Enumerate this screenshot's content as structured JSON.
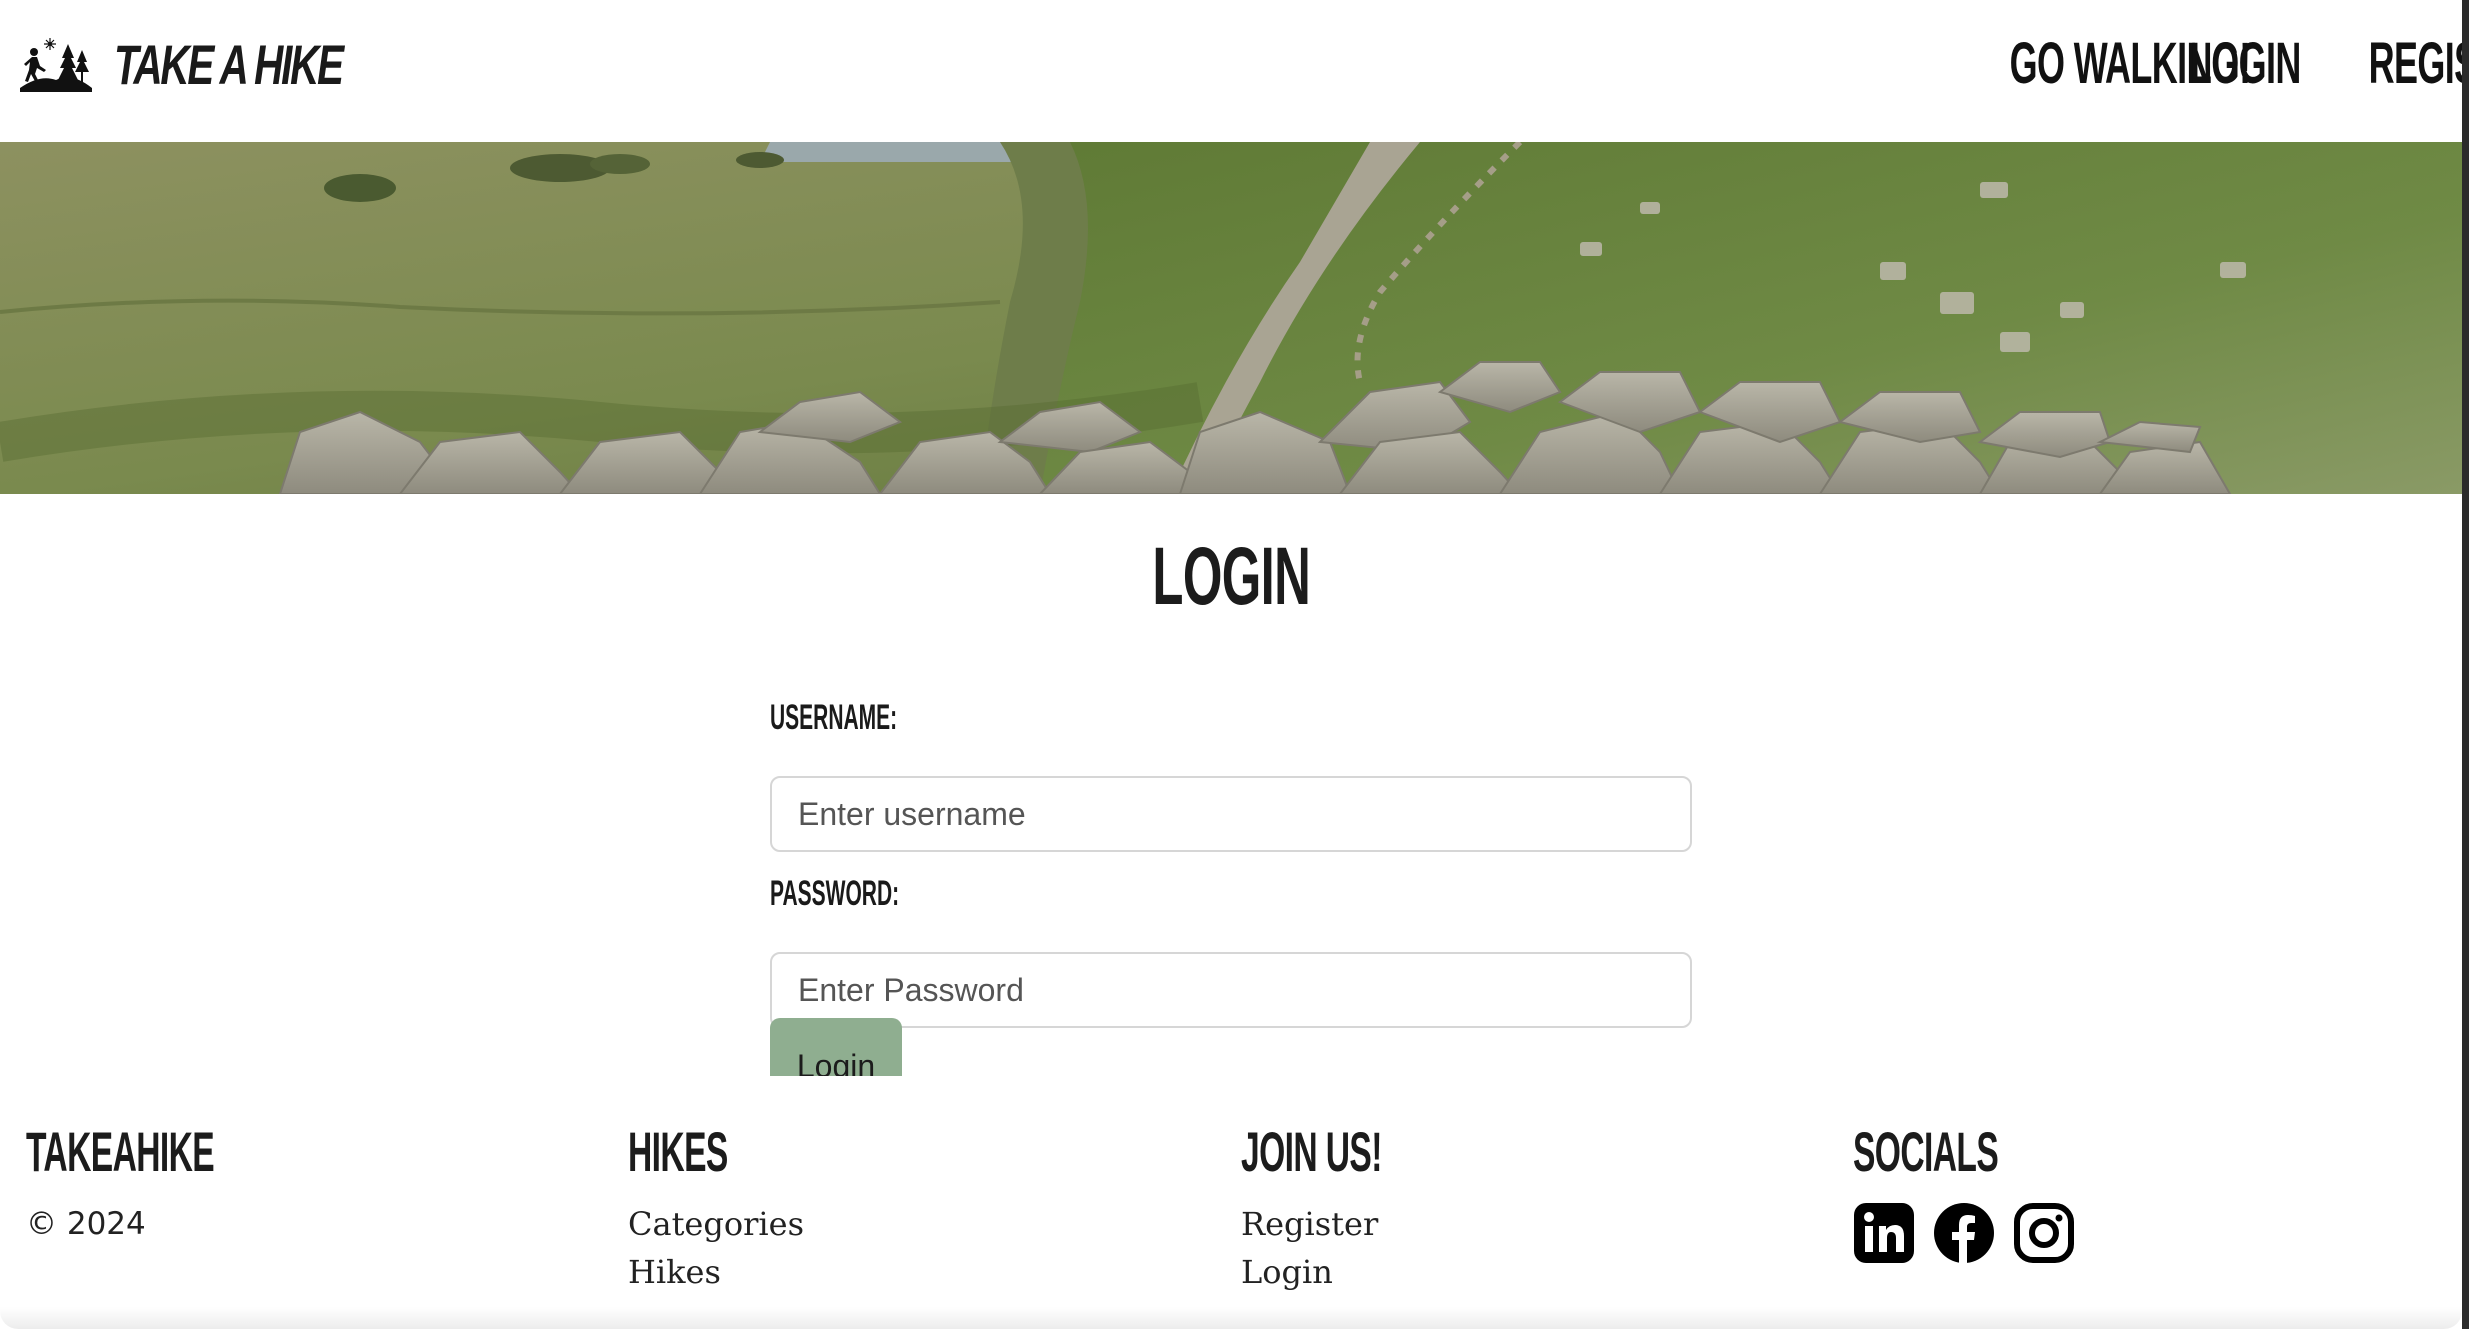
{
  "navbar": {
    "brand": "TAKE A HIKE",
    "brand_icon": "hiker-trees-icon",
    "links": [
      "GO WALKING!",
      "LOGIN",
      "REGISTER"
    ]
  },
  "hero": {
    "image": "rocky-wall-landscape"
  },
  "login": {
    "title": "LOGIN",
    "username_label": "USERNAME:",
    "username_placeholder": "Enter username",
    "password_label": "PASSWORD:",
    "password_placeholder": "Enter Password",
    "button": "Login",
    "button_color": "#8fae90"
  },
  "footer": {
    "col1": {
      "heading": "TAKEAHIKE",
      "text": "© 2024"
    },
    "col2": {
      "heading": "HIKES",
      "links": [
        "Categories",
        "Hikes"
      ]
    },
    "col3": {
      "heading": "JOIN US!",
      "links": [
        "Register",
        "Login"
      ]
    },
    "col4": {
      "heading": "SOCIALS",
      "icons": [
        "linkedin-icon",
        "facebook-icon",
        "instagram-icon"
      ]
    }
  }
}
